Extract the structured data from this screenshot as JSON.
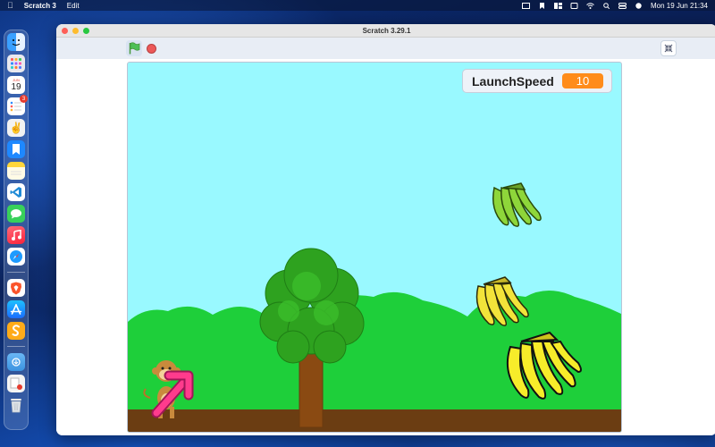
{
  "menubar": {
    "app_name": "Scratch 3",
    "edit_label": "Edit",
    "clock": "Mon 19 Jun  21:34"
  },
  "dock": {
    "calendar_day": "19",
    "calendar_month": "JUN",
    "reminders_badge": "3",
    "items": [
      "finder-icon",
      "launchpad-icon",
      "calendar-icon",
      "reminders-icon",
      "peace-app-icon",
      "bookmarks-icon",
      "notes-icon",
      "vscode-icon",
      "messages-icon",
      "music-icon",
      "safari-icon",
      "brave-icon",
      "app-store-icon",
      "scratch-icon",
      "downloads-folder-icon",
      "documents-stack-icon",
      "trash-icon"
    ]
  },
  "window": {
    "title": "Scratch 3.29.1"
  },
  "toolbar": {
    "green_flag": "green-flag-icon",
    "stop": "stop-icon",
    "fullscreen": "unfullscreen-icon"
  },
  "stage": {
    "monitor_label": "LaunchSpeed",
    "monitor_value": "10",
    "sprites": [
      "monkey",
      "aim-arrow",
      "tree",
      "banana-bunch-green",
      "banana-bunch-yellow-small",
      "banana-bunch-yellow-large"
    ]
  },
  "colors": {
    "sky": "#99f9ff",
    "grass": "#1ecf3a",
    "ground": "#6b3d12",
    "monitor_value_bg": "#ff8c1a",
    "arrow": "#ff3b8d"
  }
}
